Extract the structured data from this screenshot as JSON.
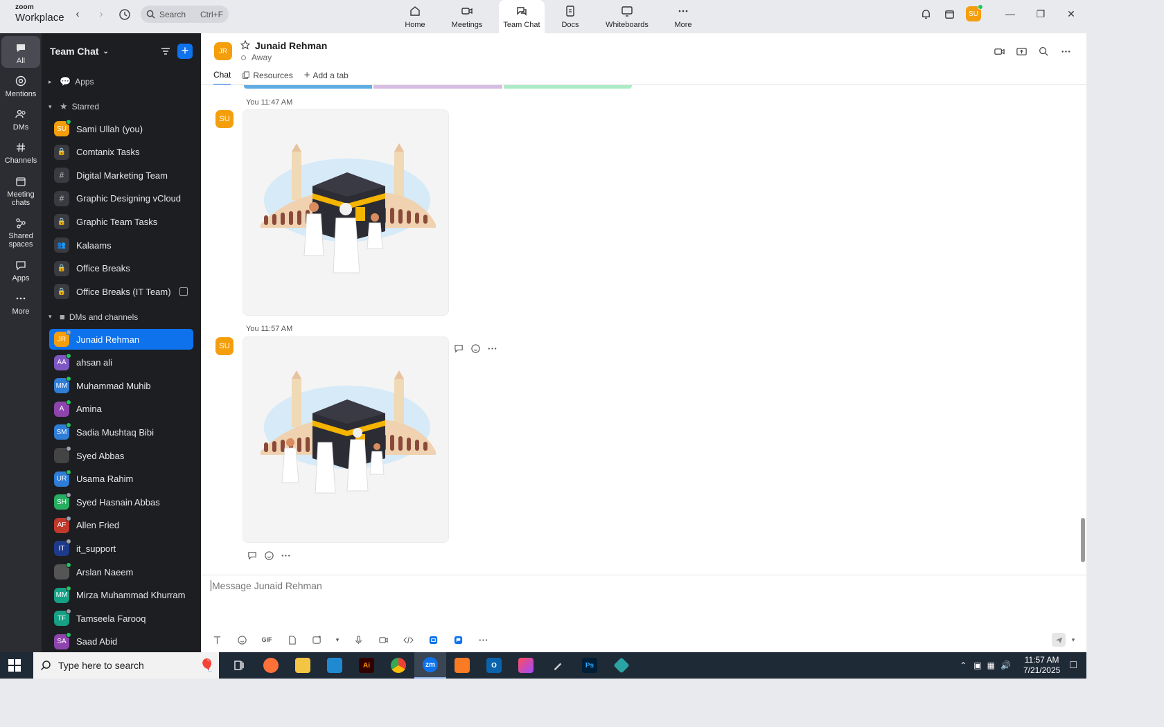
{
  "window": {
    "logo_line1": "zoom",
    "logo_line2": "Workplace",
    "search_label": "Search",
    "search_shortcut": "Ctrl+F",
    "nav_tabs": [
      {
        "label": "Home",
        "icon": "home-icon"
      },
      {
        "label": "Meetings",
        "icon": "video-icon"
      },
      {
        "label": "Team Chat",
        "icon": "chat-icon",
        "active": true
      },
      {
        "label": "Docs",
        "icon": "doc-icon"
      },
      {
        "label": "Whiteboards",
        "icon": "whiteboard-icon"
      },
      {
        "label": "More",
        "icon": "more-icon"
      }
    ],
    "user_initials": "SU"
  },
  "rail": {
    "items": [
      {
        "label": "All",
        "icon": "chat-bubble-icon",
        "active": true
      },
      {
        "label": "Mentions",
        "icon": "at-icon"
      },
      {
        "label": "DMs",
        "icon": "people-icon"
      },
      {
        "label": "Channels",
        "icon": "hash-icon"
      },
      {
        "label": "Meeting\nchats",
        "icon": "calendar-icon"
      },
      {
        "label": "Shared\nspaces",
        "icon": "share-icon"
      },
      {
        "label": "Apps",
        "icon": "apps-icon"
      },
      {
        "label": "More",
        "icon": "more-icon"
      }
    ]
  },
  "sidebar": {
    "title": "Team Chat",
    "sections": {
      "apps": "Apps",
      "starred": "Starred",
      "dms": "DMs and channels"
    },
    "starred": [
      {
        "name": "Sami Ullah (you)",
        "type": "avatar",
        "initials": "SU",
        "color": "#f59e0b",
        "status": "#22c55e"
      },
      {
        "name": "Comtanix Tasks",
        "type": "lock"
      },
      {
        "name": "Digital Marketing Team",
        "type": "hash"
      },
      {
        "name": "Graphic Designing vCloud",
        "type": "hash"
      },
      {
        "name": "Graphic Team Tasks",
        "type": "lock"
      },
      {
        "name": "Kalaams",
        "type": "group"
      },
      {
        "name": "Office Breaks",
        "type": "lock"
      },
      {
        "name": "Office Breaks (IT Team)",
        "type": "lock",
        "archived": true
      }
    ],
    "dms": [
      {
        "name": "Junaid Rehman",
        "initials": "JR",
        "color": "#f59e0b",
        "status": "#9ca3af",
        "active": true
      },
      {
        "name": "ahsan ali",
        "initials": "AA",
        "color": "#7e57c2",
        "status": "#22c55e"
      },
      {
        "name": "Muhammad Muhib",
        "initials": "MM",
        "color": "#2e7dd7",
        "status": "#22c55e"
      },
      {
        "name": "Amina",
        "initials": "A",
        "color": "#8e44ad",
        "status": "#22c55e"
      },
      {
        "name": "Sadia Mushtaq Bibi",
        "initials": "SM",
        "color": "#2e7dd7",
        "status": "#22c55e"
      },
      {
        "name": "Syed Abbas",
        "initials": "",
        "color": "#444444",
        "status": "#9ca3af"
      },
      {
        "name": "Usama Rahim",
        "initials": "UR",
        "color": "#2e7dd7",
        "status": "#22c55e"
      },
      {
        "name": "Syed Hasnain Abbas",
        "initials": "SH",
        "color": "#27ae60",
        "status": "#9ca3af"
      },
      {
        "name": "Allen Fried",
        "initials": "AF",
        "color": "#c0392b",
        "status": "#9ca3af"
      },
      {
        "name": "it_support",
        "initials": "IT",
        "color": "#1e3a8a",
        "status": "#9ca3af"
      },
      {
        "name": "Arslan Naeem",
        "initials": "",
        "color": "#555555",
        "status": "#22c55e"
      },
      {
        "name": "Mirza Muhammad Khurram",
        "initials": "MM",
        "color": "#16a085",
        "status": "#22c55e"
      },
      {
        "name": "Tamseela Farooq",
        "initials": "TF",
        "color": "#16a085",
        "status": "#9ca3af"
      },
      {
        "name": "Saad Abid",
        "initials": "SA",
        "color": "#8e44ad",
        "status": "#22c55e"
      }
    ]
  },
  "chat": {
    "contact_initials": "JR",
    "contact_name": "Junaid Rehman",
    "contact_status": "Away",
    "tabs": {
      "chat": "Chat",
      "resources": "Resources",
      "add": "Add a tab"
    },
    "messages": [
      {
        "sender": "You",
        "time": "11:47 AM",
        "initials": "SU"
      },
      {
        "sender": "You",
        "time": "11:57 AM",
        "initials": "SU"
      }
    ],
    "composer_placeholder": "Message Junaid Rehman",
    "toolbar_gif": "GIF"
  },
  "taskbar": {
    "search_placeholder": "Type here to search",
    "time": "11:57 AM",
    "date": "7/21/2025"
  },
  "colors": {
    "accent": "#0e72ed",
    "rail_bg": "#2c2d33",
    "sidebar_bg": "#1d1e22",
    "online": "#22c55e"
  }
}
